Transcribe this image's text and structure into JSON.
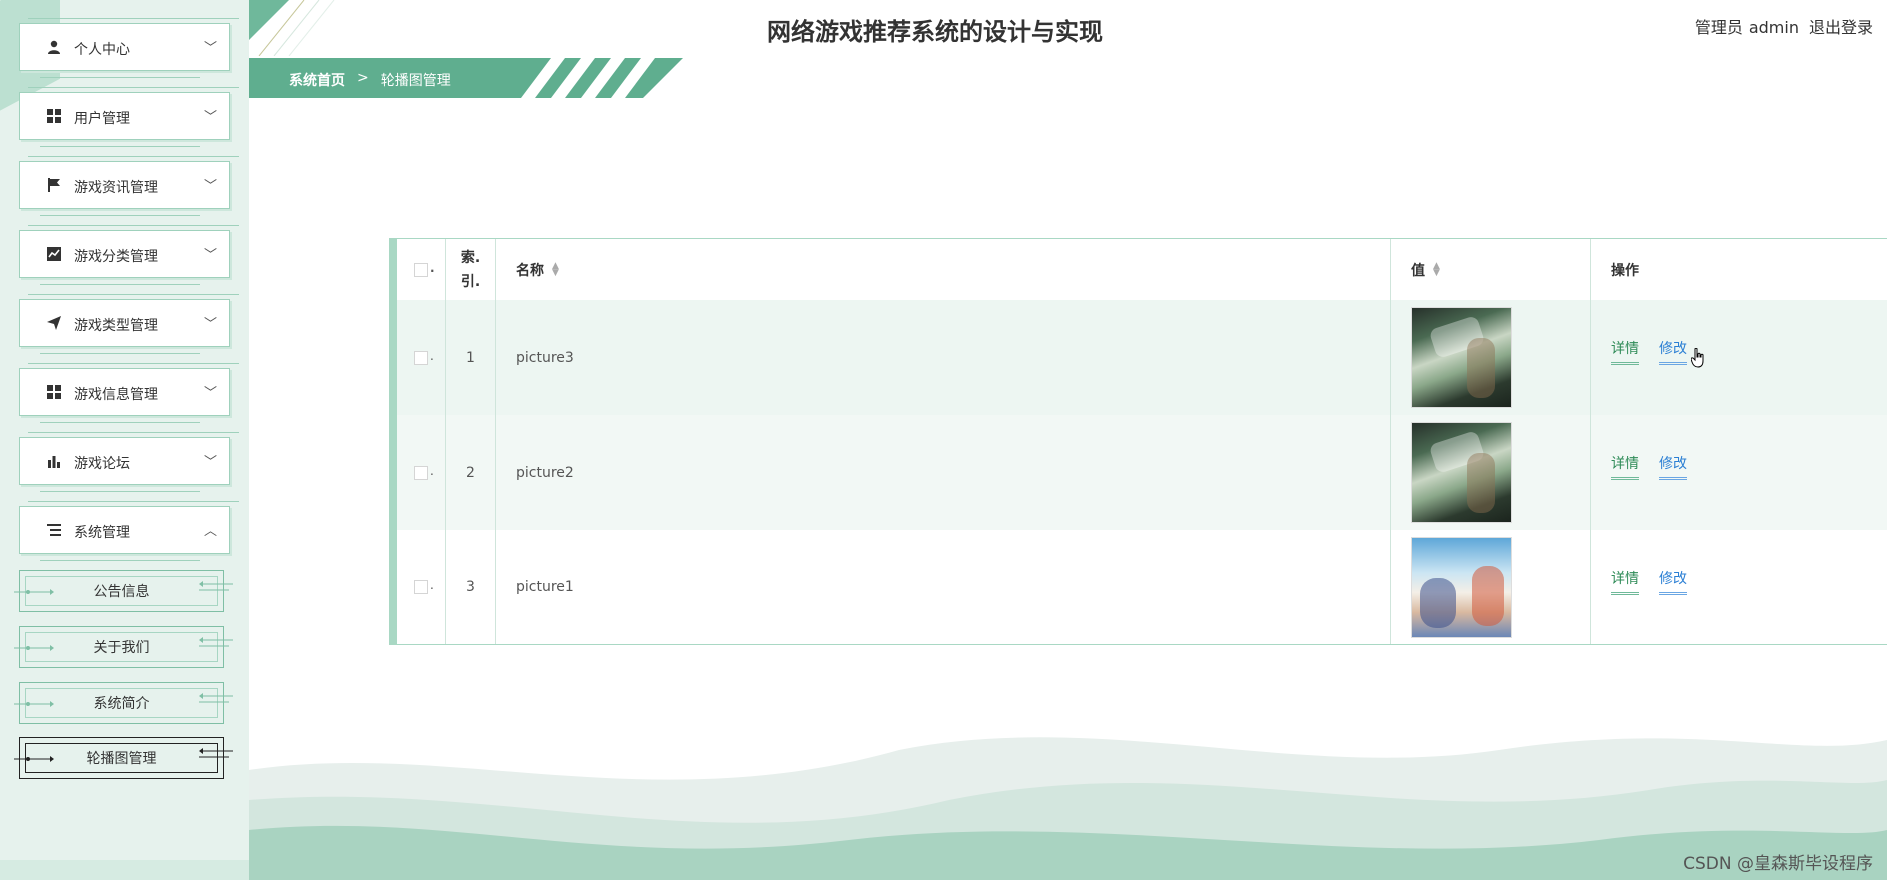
{
  "app": {
    "title": "网络游戏推荐系统的设计与实现",
    "user_role": "管理员",
    "username": "admin",
    "logout_label": "退出登录"
  },
  "sidebar": {
    "items": [
      {
        "label": "个人中心",
        "icon": "person-icon"
      },
      {
        "label": "用户管理",
        "icon": "grid-icon"
      },
      {
        "label": "游戏资讯管理",
        "icon": "flag-icon"
      },
      {
        "label": "游戏分类管理",
        "icon": "trend-chart-icon"
      },
      {
        "label": "游戏类型管理",
        "icon": "paper-plane-icon"
      },
      {
        "label": "游戏信息管理",
        "icon": "grid-icon"
      },
      {
        "label": "游戏论坛",
        "icon": "bar-chart-icon"
      },
      {
        "label": "系统管理",
        "icon": "list-icon",
        "expanded": true
      }
    ],
    "sub_items": [
      {
        "label": "公告信息"
      },
      {
        "label": "关于我们"
      },
      {
        "label": "系统简介"
      },
      {
        "label": "轮播图管理",
        "active": true
      }
    ]
  },
  "breadcrumb": {
    "home": "系统首页",
    "separator": ">",
    "current": "轮播图管理"
  },
  "table": {
    "columns": {
      "index_line1": "索.",
      "index_line2": "引.",
      "name": "名称",
      "value": "值",
      "actions": "操作"
    },
    "rows": [
      {
        "index": "1",
        "name": "picture3",
        "image": "forest-banner"
      },
      {
        "index": "2",
        "name": "picture2",
        "image": "forest-banner"
      },
      {
        "index": "3",
        "name": "picture1",
        "image": "game-banner"
      }
    ],
    "detail_label": "详情",
    "edit_label": "修改"
  },
  "colors": {
    "accent": "#5fae8f",
    "sidebar_bg": "#e6f2ed",
    "edit_link": "#2b7fd4"
  },
  "watermark": "CSDN @皇森斯毕设程序"
}
